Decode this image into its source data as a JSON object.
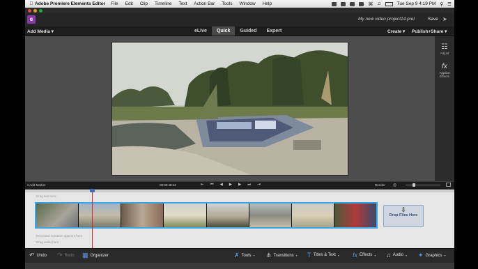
{
  "menubar": {
    "app_name": "Adobe Premiere Elements Editor",
    "items": [
      "File",
      "Edit",
      "Clip",
      "Timeline",
      "Text",
      "Action Bar",
      "Tools",
      "Window",
      "Help"
    ],
    "clock": "Tue Sep 9  4:19 PM"
  },
  "project": {
    "name": "My new video project14.prel",
    "save_label": "Save"
  },
  "modebar": {
    "add_media": "Add Media ▾",
    "modes": [
      "eLive",
      "Quick",
      "Guided",
      "Expert"
    ],
    "active_mode": "Quick",
    "create": "Create ▾",
    "publish_share": "Publish+Share ▾"
  },
  "rpanel": {
    "adjust": "Adjust",
    "applied_effects": "Applied Effects"
  },
  "transport": {
    "add_marker": "▾ Add Marker",
    "timecode": "00:00:48:12",
    "render": "Render"
  },
  "timeline": {
    "text_track_hint": "Drag text here",
    "narration_hint": "Recorded narration appears here",
    "audio_hint": "Drag audio here",
    "drop_files": "Drop Files Here"
  },
  "actionbar": {
    "undo": "Undo",
    "redo": "Redo",
    "organizer": "Organizer",
    "tools": "Tools",
    "transitions": "Transitions",
    "titles_text": "Titles & Text",
    "effects": "Effects",
    "audio": "Audio",
    "graphics": "Graphics"
  }
}
